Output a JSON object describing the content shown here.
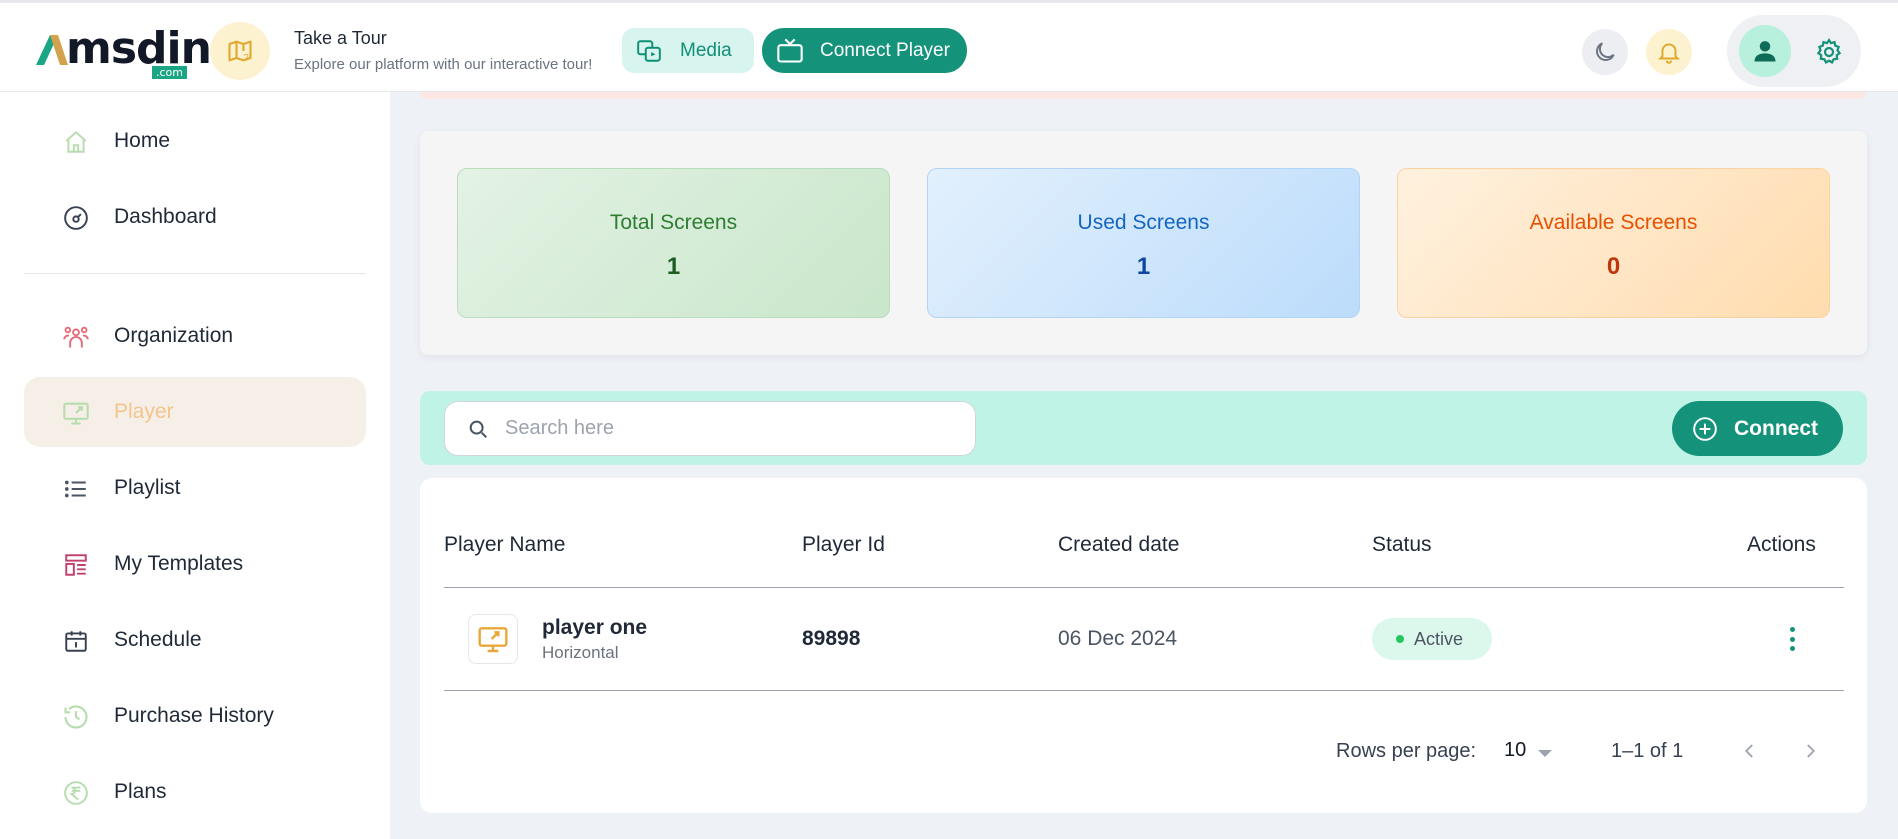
{
  "header": {
    "logo_text": "msdin",
    "logo_suffix": ".com",
    "tour_title": "Take a Tour",
    "tour_subtitle": "Explore our platform with our interactive tour!",
    "media_label": "Media",
    "connect_player_label": "Connect Player"
  },
  "sidebar": {
    "items": [
      {
        "label": "Home",
        "icon": "home-icon"
      },
      {
        "label": "Dashboard",
        "icon": "dashboard-icon"
      },
      {
        "label": "Organization",
        "icon": "organization-icon"
      },
      {
        "label": "Player",
        "icon": "monitor-icon",
        "active": true
      },
      {
        "label": "Playlist",
        "icon": "list-icon"
      },
      {
        "label": "My Templates",
        "icon": "template-icon"
      },
      {
        "label": "Schedule",
        "icon": "calendar-icon"
      },
      {
        "label": "Purchase History",
        "icon": "history-icon"
      },
      {
        "label": "Plans",
        "icon": "rupee-icon"
      }
    ]
  },
  "stats": {
    "total_label": "Total Screens",
    "total_value": "1",
    "used_label": "Used Screens",
    "used_value": "1",
    "available_label": "Available Screens",
    "available_value": "0"
  },
  "search": {
    "placeholder": "Search here",
    "connect_label": "Connect"
  },
  "table": {
    "columns": [
      "Player Name",
      "Player Id",
      "Created date",
      "Status",
      "Actions"
    ],
    "rows": [
      {
        "name": "player one",
        "orientation": "Horizontal",
        "id": "89898",
        "created": "06 Dec 2024",
        "status": "Active"
      }
    ]
  },
  "pagination": {
    "rows_per_page_label": "Rows per page:",
    "rows_per_page_value": "10",
    "range": "1–1 of 1"
  },
  "colors": {
    "accent": "#15937a",
    "active_nav_bg": "#f6efe7",
    "search_band": "#bff3e6"
  }
}
